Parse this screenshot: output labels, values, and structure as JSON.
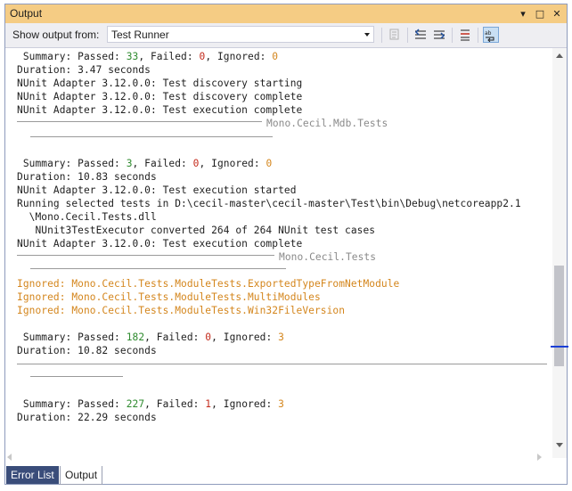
{
  "window": {
    "title": "Output"
  },
  "title_controls": {
    "dropdown": "▾",
    "maximize": "□",
    "close": "✕"
  },
  "toolbar": {
    "show_output_label": "Show output from:",
    "source_selected": "Test Runner",
    "icons": [
      "go-to-line-icon",
      "prev-message-icon",
      "next-message-icon",
      "clear-all-icon",
      "word-wrap-icon"
    ]
  },
  "output_lines": {
    "l1a": " Summary: Passed: ",
    "l1b": "33",
    "l1c": ", Failed: ",
    "l1d": "0",
    "l1e": ", Ignored: ",
    "l1f": "0",
    "l2": "Duration: 3.47 seconds",
    "l3": "NUnit Adapter 3.12.0.0: Test discovery starting",
    "l4": "NUnit Adapter 3.12.0.0: Test discovery complete",
    "l5": "NUnit Adapter 3.12.0.0: Test execution complete",
    "sec1": "Mono.Cecil.Mdb.Tests",
    "l6a": " Summary: Passed: ",
    "l6b": "3",
    "l6c": ", Failed: ",
    "l6d": "0",
    "l6e": ", Ignored: ",
    "l6f": "0",
    "l7": "Duration: 10.83 seconds",
    "l8": "NUnit Adapter 3.12.0.0: Test execution started",
    "l9": "Running selected tests in D:\\cecil-master\\cecil-master\\Test\\bin\\Debug\\netcoreapp2.1",
    "l10": "  \\Mono.Cecil.Tests.dll",
    "l11": "   NUnit3TestExecutor converted 264 of 264 NUnit test cases",
    "l12": "NUnit Adapter 3.12.0.0: Test execution complete",
    "sec2": "Mono.Cecil.Tests",
    "ig1": "Ignored: Mono.Cecil.Tests.ModuleTests.ExportedTypeFromNetModule",
    "ig2": "Ignored: Mono.Cecil.Tests.ModuleTests.MultiModules",
    "ig3": "Ignored: Mono.Cecil.Tests.ModuleTests.Win32FileVersion",
    "l13a": " Summary: Passed: ",
    "l13b": "182",
    "l13c": ", Failed: ",
    "l13d": "0",
    "l13e": ", Ignored: ",
    "l13f": "3",
    "l14": "Duration: 10.82 seconds",
    "l15a": " Summary: Passed: ",
    "l15b": "227",
    "l15c": ", Failed: ",
    "l15d": "1",
    "l15e": ", Ignored: ",
    "l15f": "3",
    "l16": "Duration: 22.29 seconds"
  },
  "tabs": [
    {
      "label": "Error List",
      "active": false
    },
    {
      "label": "Output",
      "active": true
    }
  ],
  "colors": {
    "title_bar": "#f5cc84",
    "passed": "#2f8b2f",
    "failed": "#c42b1c",
    "ignored": "#d4861d",
    "active_tab": "#3a4d7a"
  }
}
